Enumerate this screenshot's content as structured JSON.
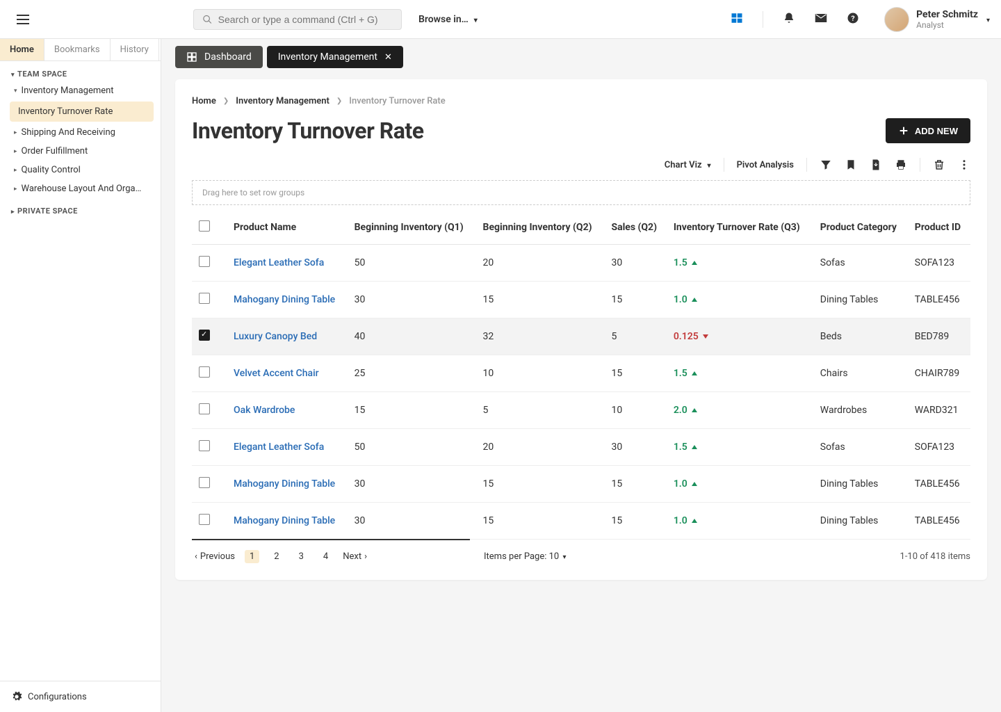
{
  "topbar": {
    "search_placeholder": "Search or type a command (Ctrl + G)",
    "browse_label": "Browse in…",
    "user": {
      "name": "Peter Schmitz",
      "role": "Analyst"
    }
  },
  "sidebar": {
    "tabs": [
      "Home",
      "Bookmarks",
      "History"
    ],
    "sections": {
      "team": "TEAM SPACE",
      "private": "PRIVATE SPACE"
    },
    "tree": [
      {
        "label": "Inventory Management",
        "open": true,
        "children": [
          {
            "label": "Inventory Turnover Rate",
            "active": true
          }
        ]
      },
      {
        "label": "Shipping And Receiving"
      },
      {
        "label": "Order Fulfillment"
      },
      {
        "label": "Quality Control"
      },
      {
        "label": "Warehouse Layout And Orga…"
      }
    ],
    "footer": "Configurations"
  },
  "tabs": [
    {
      "label": "Dashboard",
      "type": "dashboard"
    },
    {
      "label": "Inventory Management",
      "type": "active",
      "closable": true
    }
  ],
  "breadcrumbs": [
    "Home",
    "Inventory Management",
    "Inventory Turnover Rate"
  ],
  "page_title": "Inventory Turnover Rate",
  "add_new_label": "ADD NEW",
  "toolbar": {
    "chart_viz": "Chart Viz",
    "pivot": "Pivot Analysis"
  },
  "drag_hint": "Drag here to set row groups",
  "columns": [
    "Product Name",
    "Beginning Inventory (Q1)",
    "Beginning Inventory (Q2)",
    "Sales (Q2)",
    "Inventory Turnover Rate (Q3)",
    "Product Category",
    "Product ID"
  ],
  "rows": [
    {
      "checked": false,
      "name": "Elegant Leather Sofa",
      "q1": "50",
      "q2": "20",
      "sales": "30",
      "rate": "1.5",
      "dir": "up",
      "cat": "Sofas",
      "id": "SOFA123"
    },
    {
      "checked": false,
      "name": "Mahogany Dining Table",
      "q1": "30",
      "q2": "15",
      "sales": "15",
      "rate": "1.0",
      "dir": "up",
      "cat": "Dining Tables",
      "id": "TABLE456"
    },
    {
      "checked": true,
      "name": "Luxury Canopy Bed",
      "q1": "40",
      "q2": "32",
      "sales": "5",
      "rate": "0.125",
      "dir": "down",
      "cat": "Beds",
      "id": "BED789"
    },
    {
      "checked": false,
      "name": "Velvet Accent Chair",
      "q1": "25",
      "q2": "10",
      "sales": "15",
      "rate": "1.5",
      "dir": "up",
      "cat": "Chairs",
      "id": "CHAIR789"
    },
    {
      "checked": false,
      "name": "Oak Wardrobe",
      "q1": "15",
      "q2": "5",
      "sales": "10",
      "rate": "2.0",
      "dir": "up",
      "cat": "Wardrobes",
      "id": "WARD321"
    },
    {
      "checked": false,
      "name": "Elegant Leather Sofa",
      "q1": "50",
      "q2": "20",
      "sales": "30",
      "rate": "1.5",
      "dir": "up",
      "cat": "Sofas",
      "id": "SOFA123"
    },
    {
      "checked": false,
      "name": "Mahogany Dining Table",
      "q1": "30",
      "q2": "15",
      "sales": "15",
      "rate": "1.0",
      "dir": "up",
      "cat": "Dining Tables",
      "id": "TABLE456"
    },
    {
      "checked": false,
      "name": "Mahogany Dining Table",
      "q1": "30",
      "q2": "15",
      "sales": "15",
      "rate": "1.0",
      "dir": "up",
      "cat": "Dining Tables",
      "id": "TABLE456"
    }
  ],
  "pager": {
    "previous": "Previous",
    "next": "Next",
    "pages": [
      "1",
      "2",
      "3",
      "4"
    ],
    "items_per_page": "Items per Page: 10",
    "count": "1-10 of 418 items"
  }
}
